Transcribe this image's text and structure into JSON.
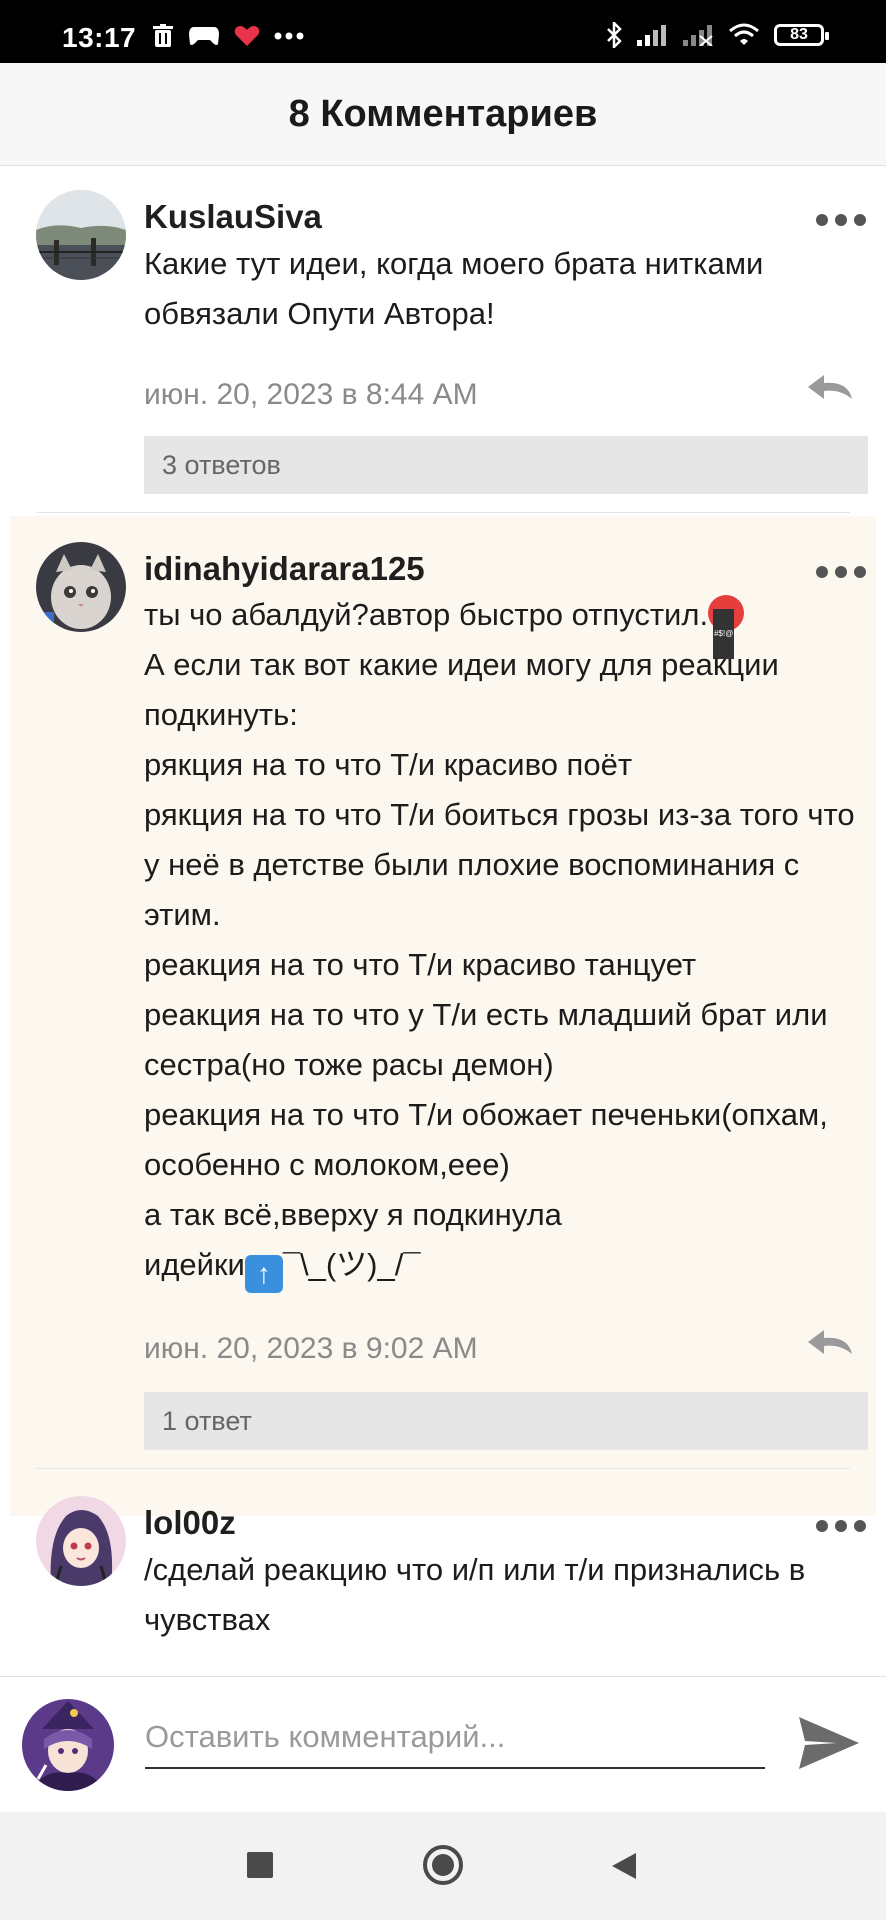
{
  "status_bar": {
    "time": "13:17",
    "battery": "83"
  },
  "header": {
    "title": "8 Комментариев"
  },
  "comments": [
    {
      "author": "KuslauSiva",
      "text": "Какие тут идеи, когда моего брата нитками обвязали Опути Автора!",
      "date": "июн. 20, 2023 в 8:44 AM",
      "replies_label": "3 ответов"
    },
    {
      "author": "idinahyidarara125",
      "text_line1": "ты чо абалдуй?автор быстро отпустил.",
      "text_body": "А если так вот какие идеи могу для реакции подкинуть:\nрякция на то что Т/и красиво поёт\nрякция на то что Т/и боиться грозы из-за того что у неё в детстве были плохие воспоминания с этим.\nреакция на то что Т/и красиво танцует\nреакция на то что у Т/и есть младший брат или сестра(но тоже расы демон)\nреакция на то что Т/и обожает печеньки(опхам, особенно с молоком,еее)\nа так всё,вверху я подкинула",
      "text_last_prefix": "идейки",
      "text_last_suffix": "¯\\_(ツ)_/¯",
      "date": "июн. 20, 2023 в 9:02 AM",
      "replies_label": "1 ответ"
    },
    {
      "author": "lol00z",
      "text": "/сделай реакцию что и/п или т/и признались в чувствах"
    }
  ],
  "input": {
    "placeholder": "Оставить комментарий..."
  },
  "colors": {
    "highlight_bg": "#fdf8ef",
    "replies_bg": "#e6e6e6",
    "date_text": "#8a8a8a"
  },
  "icons": [
    "trash-icon",
    "gamepad-icon",
    "heart-icon",
    "more-icon",
    "bluetooth-icon",
    "signal-icon",
    "wifi-icon",
    "battery-icon",
    "reply-icon",
    "send-icon",
    "recents-icon",
    "home-icon",
    "back-icon"
  ]
}
